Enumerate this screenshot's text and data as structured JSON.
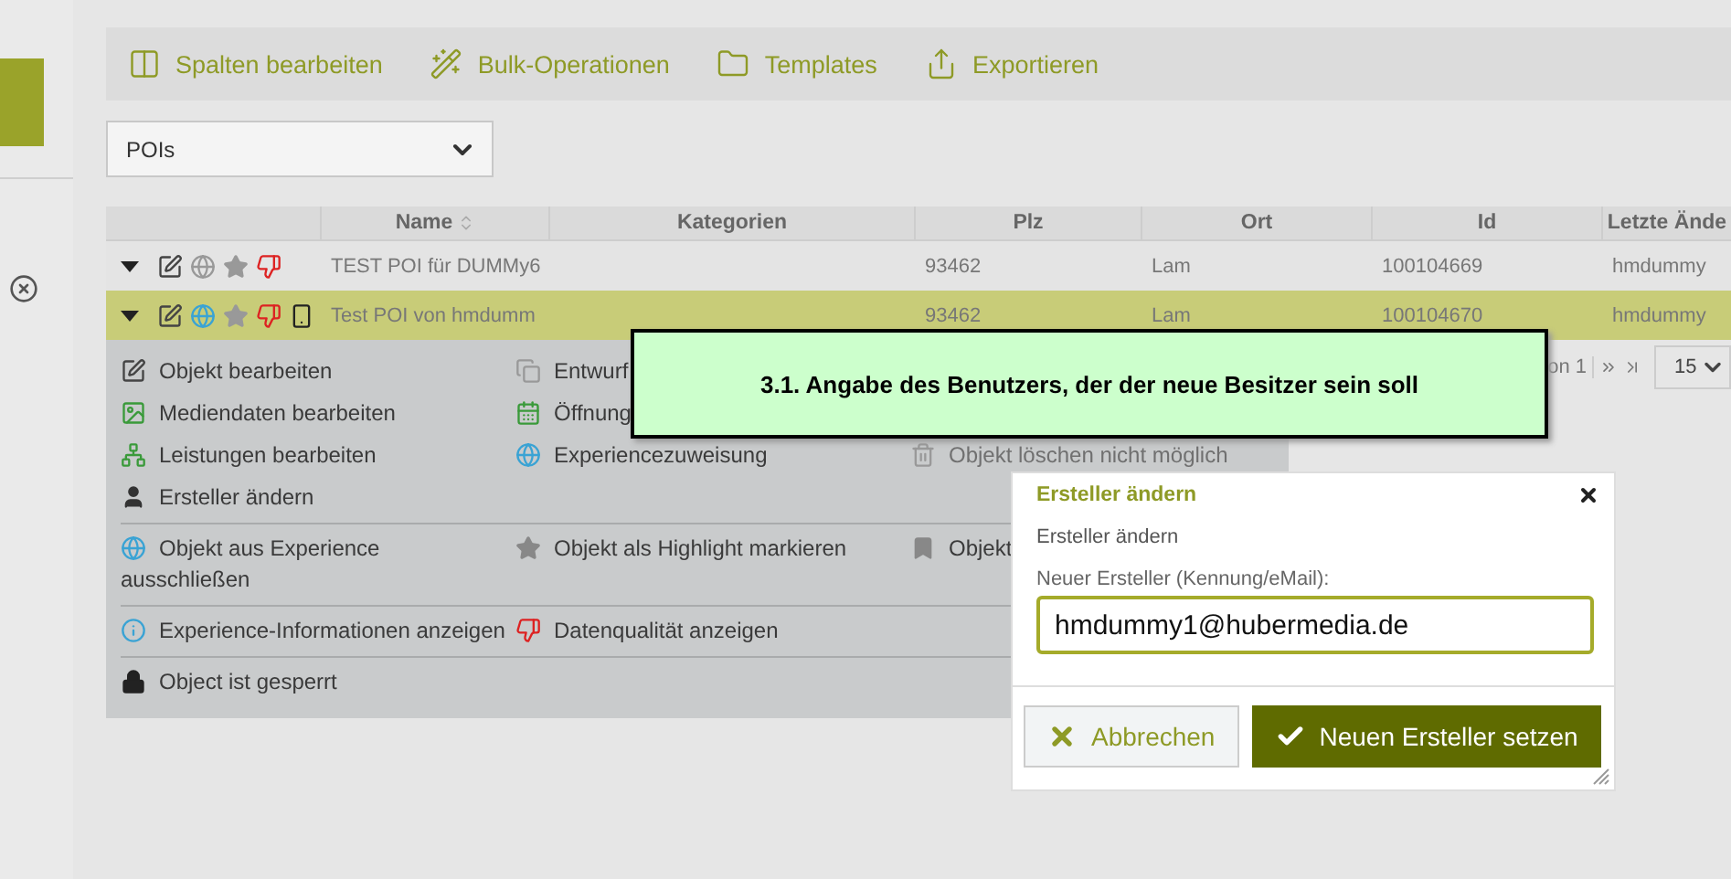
{
  "toolbar": [
    {
      "label": "Spalten bearbeiten"
    },
    {
      "label": "Bulk-Operationen"
    },
    {
      "label": "Templates"
    },
    {
      "label": "Exportieren"
    }
  ],
  "list_select": {
    "value": "POIs"
  },
  "table": {
    "columns": [
      {
        "label": "Name",
        "sort_icon": true
      },
      {
        "label": "Kategorien",
        "sort_icon": false
      },
      {
        "label": "Plz",
        "sort_icon": false
      },
      {
        "label": "Ort",
        "sort_icon": false
      },
      {
        "label": "Id",
        "sort_icon": false
      },
      {
        "label": "Letzte Ände",
        "sort_icon": false
      }
    ],
    "rows": [
      {
        "selected": false,
        "experience": false,
        "mobile": false,
        "name": "TEST POI für DUMMy6",
        "plz": "93462",
        "ort": "Lam",
        "id": "100104669",
        "last": "hmdummy"
      },
      {
        "selected": true,
        "experience": true,
        "mobile": true,
        "name": "Test POI von hmdumm",
        "plz": "93462",
        "ort": "Lam",
        "id": "100104670",
        "last": "hmdummy"
      }
    ]
  },
  "actions": [
    {
      "rows": [
        [
          {
            "label": "Objekt bearbeiten",
            "disabled": false
          },
          {
            "label": "Entwurf",
            "disabled": false
          }
        ],
        [
          {
            "label": "Mediendaten bearbeiten",
            "disabled": false
          },
          {
            "label": "Öffnung",
            "disabled": false
          }
        ],
        [
          {
            "label": "Leistungen bearbeiten",
            "disabled": false
          },
          {
            "label": "Experiencezuweisung",
            "disabled": false
          },
          {
            "label": "Objekt löschen nicht möglich",
            "disabled": true
          }
        ],
        [
          {
            "label": "Ersteller ändern",
            "disabled": false
          }
        ]
      ]
    },
    {
      "rows": [
        [
          {
            "label": "Objekt aus Experience\nausschließen",
            "disabled": false
          },
          {
            "label": "Objekt als Highlight markieren",
            "disabled": false
          },
          {
            "label": "Objekt",
            "disabled": false
          }
        ]
      ]
    },
    {
      "rows": [
        [
          {
            "label": "Experience-Informationen anzeigen",
            "disabled": false
          },
          {
            "label": "Datenqualität anzeigen",
            "disabled": false
          }
        ]
      ]
    },
    {
      "rows": [
        [
          {
            "label": "Object ist gesperrt",
            "disabled": false
          }
        ]
      ]
    }
  ],
  "pager": {
    "text": "on 1",
    "page_size": "15"
  },
  "tooltip": {
    "text": "3.1. Angabe des Benutzers, der der neue Besitzer sein soll"
  },
  "dialog": {
    "title": "Ersteller ändern",
    "subtitle": "Ersteller ändern",
    "field_label": "Neuer Ersteller (Kennung/eMail):",
    "field_value": "hmdummy1@hubermedia.de",
    "buttons": [
      {
        "label": "Abbrechen",
        "kind": "cancel"
      },
      {
        "label": "Neuen Ersteller setzen",
        "kind": "confirm"
      }
    ]
  }
}
